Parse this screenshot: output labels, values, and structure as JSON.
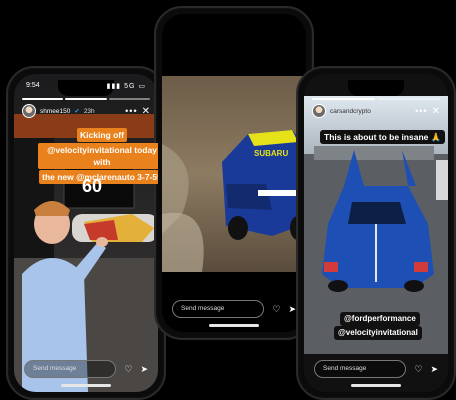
{
  "phones": {
    "left": {
      "time": "9:54",
      "status_icons": "▮▮▮ 5G ▭",
      "username": "shmee150",
      "verified_badge": "verified-badge-icon",
      "timestamp": "23h",
      "caption_lines": [
        "Kicking off",
        "@velocityinvitational today with",
        "the new @mclarenauto 3-7-59"
      ],
      "tv_text": "60",
      "reply_placeholder": "Send message"
    },
    "center": {
      "car_livery": "SUBARU",
      "reply_placeholder": "Send message"
    },
    "right": {
      "username": "carsandcrypto",
      "caption": "This is about to be insane 🙏",
      "tags": [
        "@fordperformance",
        "@velocityinvitational"
      ],
      "reply_placeholder": "Send message"
    }
  },
  "colors": {
    "caption_orange": "#e9821c",
    "background": "#000000",
    "ford_blue": "#1d4fb5",
    "subaru_blue": "#1a3a9a",
    "subaru_yellow": "#e6e21a"
  },
  "icons": [
    "heart-icon",
    "send-icon",
    "close-icon",
    "more-icon"
  ]
}
